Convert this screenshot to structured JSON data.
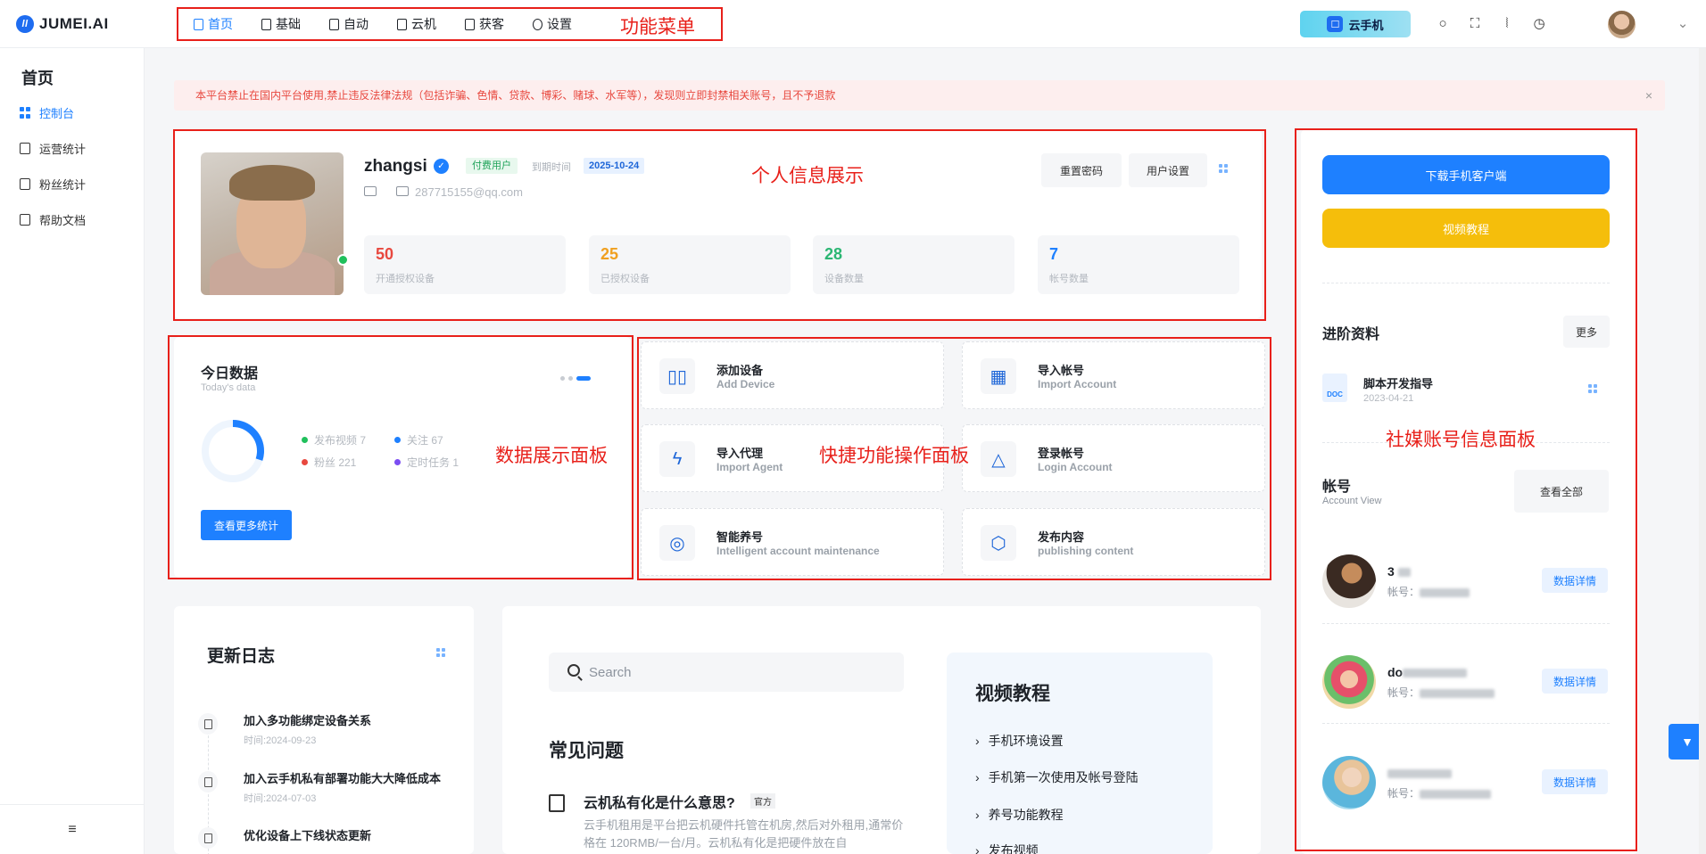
{
  "brand": {
    "name": "JUMEI.AI"
  },
  "top_menu": [
    {
      "label": "首页",
      "icon": "home-icon",
      "active": true
    },
    {
      "label": "基础",
      "icon": "doc-icon"
    },
    {
      "label": "自动",
      "icon": "auto-icon"
    },
    {
      "label": "云机",
      "icon": "doc-icon"
    },
    {
      "label": "获客",
      "icon": "doc-icon"
    },
    {
      "label": "设置",
      "icon": "gear-icon"
    }
  ],
  "annotations": {
    "menu": "功能菜单",
    "profile": "个人信息展示",
    "data": "数据展示面板",
    "quick": "快捷功能操作面板",
    "social": "社媒账号信息面板"
  },
  "cloud_phone": {
    "label": "云手机"
  },
  "sidebar": {
    "title": "首页",
    "items": [
      {
        "label": "控制台",
        "active": true
      },
      {
        "label": "运营统计"
      },
      {
        "label": "粉丝统计"
      },
      {
        "label": "帮助文档"
      }
    ],
    "collapse_icon": "≡"
  },
  "notice": {
    "text": "本平台禁止在国内平台使用,禁止违反法律法规（包括诈骗、色情、贷款、博彩、赌球、水军等），发现则立即封禁相关账号，且不予退款",
    "close": "×"
  },
  "profile": {
    "username": "zhangsi",
    "tag": "付费用户",
    "expire_label": "到期时间",
    "expire_date": "2025-10-24",
    "email": "287715155@qq.com",
    "reset_password": "重置密码",
    "user_settings": "用户设置",
    "stats": [
      {
        "value": "50",
        "label": "开通授权设备",
        "color": "#e8483f"
      },
      {
        "value": "25",
        "label": "已授权设备",
        "color": "#f0a020"
      },
      {
        "value": "28",
        "label": "设备数量",
        "color": "#2bb673"
      },
      {
        "value": "7",
        "label": "帐号数量",
        "color": "#1e80ff"
      }
    ]
  },
  "today": {
    "title": "今日数据",
    "subtitle": "Today's data",
    "progress": 0.3,
    "legend": [
      {
        "label": "发布视频 7",
        "color": "#20c05c"
      },
      {
        "label": "关注 67",
        "color": "#1e80ff"
      },
      {
        "label": "粉丝 221",
        "color": "#e8483f"
      },
      {
        "label": "定时任务 1",
        "color": "#7b4df2"
      }
    ],
    "more_button": "查看更多统计"
  },
  "quick_actions": [
    {
      "title": "添加设备",
      "sub": "Add Device",
      "icon": "device-icon",
      "glyph": "▯▯"
    },
    {
      "title": "导入帐号",
      "sub": "Import Account",
      "icon": "grid-icon",
      "glyph": "▦"
    },
    {
      "title": "导入代理",
      "sub": "Import Agent",
      "icon": "lightning-icon",
      "glyph": "ϟ"
    },
    {
      "title": "登录帐号",
      "sub": "Login Account",
      "icon": "shapes-icon",
      "glyph": "△"
    },
    {
      "title": "智能养号",
      "sub": "Intelligent account maintenance",
      "icon": "aperture-icon",
      "glyph": "◎"
    },
    {
      "title": "发布内容",
      "sub": "publishing content",
      "icon": "hexagon-icon",
      "glyph": "⬡"
    }
  ],
  "right_panel": {
    "download_btn": "下载手机客户端",
    "video_btn": "视频教程",
    "download_color": "#1e80ff",
    "video_color": "#f5be0b",
    "advanced_title": "进阶资料",
    "more_btn": "更多",
    "doc": {
      "badge": "DOC",
      "title": "脚本开发指导",
      "date": "2023-04-21"
    },
    "account_title": "帐号",
    "account_sub": "Account View",
    "view_all": "查看全部",
    "accounts": [
      {
        "name": "3",
        "id_label": "帐号：",
        "detail": "数据详情"
      },
      {
        "name": "do",
        "id_label": "帐号：",
        "detail": "数据详情"
      },
      {
        "name": "",
        "id_label": "帐号：",
        "detail": "数据详情"
      }
    ]
  },
  "changelog": {
    "title": "更新日志",
    "items": [
      {
        "text": "加入多功能绑定设备关系",
        "time": "时间:2024-09-23"
      },
      {
        "text": "加入云手机私有部署功能大大降低成本",
        "time": "时间:2024-07-03"
      },
      {
        "text": "优化设备上下线状态更新",
        "time": ""
      }
    ]
  },
  "search": {
    "placeholder": "Search"
  },
  "faq": {
    "title": "常见问题",
    "question": "云机私有化是什么意思?",
    "tag": "官方",
    "answer": "云手机租用是平台把云机硬件托管在机房,然后对外租用,通常价格在 120RMB/一台/月。云机私有化是把硬件放在自"
  },
  "video_tutorials": {
    "title": "视频教程",
    "items": [
      "手机环境设置",
      "手机第一次使用及帐号登陆",
      "养号功能教程",
      "发布视频"
    ]
  }
}
